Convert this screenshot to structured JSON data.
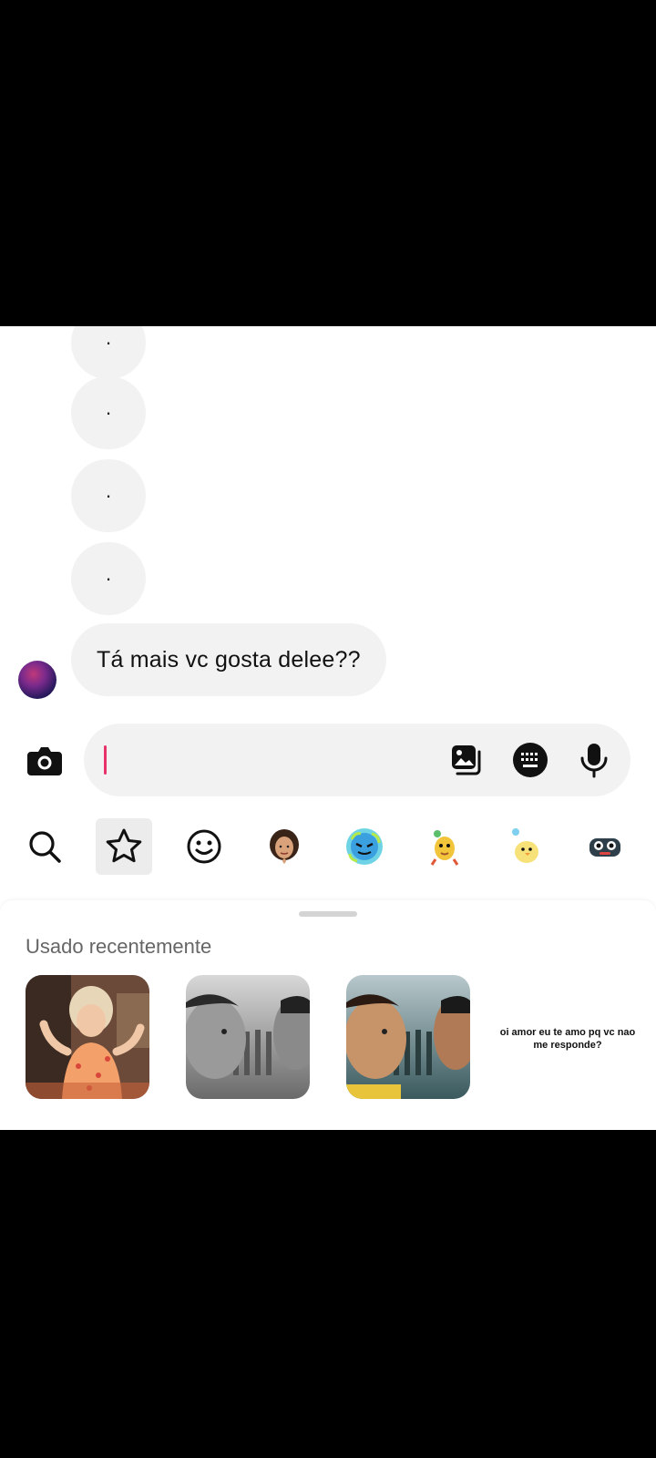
{
  "chat": {
    "dot_messages": [
      ".",
      ".",
      ".",
      "."
    ],
    "last_message": "Tá mais vc gosta delee??"
  },
  "composer": {
    "placeholder": "",
    "icons": [
      "camera-icon",
      "gallery-icon",
      "keyboard-icon",
      "microphone-icon"
    ]
  },
  "sticker_tabs": [
    "search-icon",
    "star-icon",
    "emoji-icon",
    "avatar-sticker-1",
    "avatar-sticker-2",
    "avatar-sticker-3",
    "avatar-sticker-4",
    "avatar-sticker-5"
  ],
  "sticker_panel": {
    "section_title": "Usado recentemente",
    "text_sticker": "oi amor eu te amo pq vc nao me responde?"
  },
  "colors": {
    "caret": "#e8326a",
    "bubble_bg": "#f2f2f2",
    "tab_active_bg": "#ececec"
  }
}
